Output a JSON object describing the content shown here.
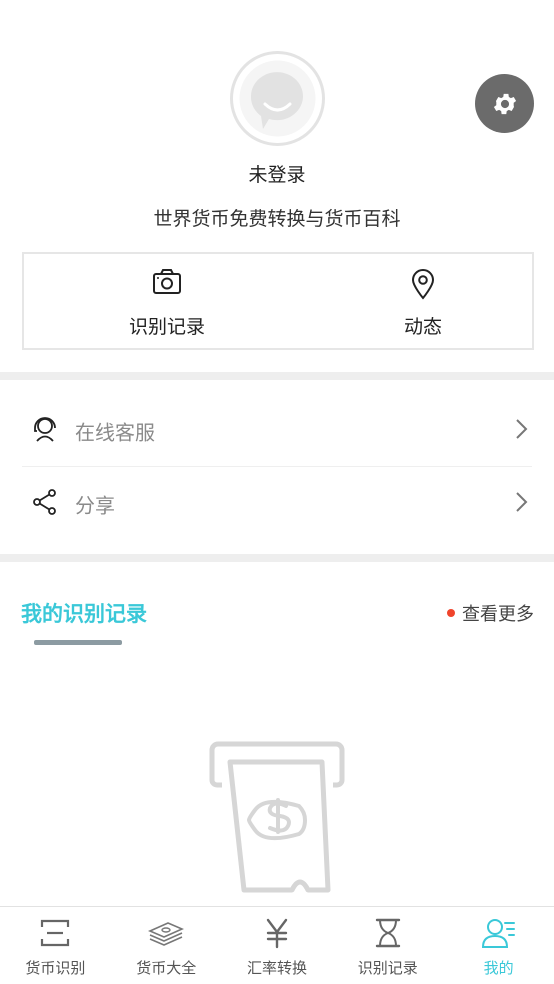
{
  "profile": {
    "login_status": "未登录",
    "subtitle": "世界货币免费转换与货币百科",
    "avatar_icon": "chat-bubble-smile-icon",
    "settings_icon": "gear-icon"
  },
  "quick_actions": [
    {
      "label": "识别记录",
      "icon": "camera-icon"
    },
    {
      "label": "动态",
      "icon": "location-pin-icon"
    }
  ],
  "menu": [
    {
      "label": "在线客服",
      "icon": "headset-agent-icon"
    },
    {
      "label": "分享",
      "icon": "share-icon"
    }
  ],
  "records": {
    "title": "我的识别记录",
    "more_label": "查看更多",
    "empty_icon": "atm-cash-icon"
  },
  "tabbar": {
    "active_index": 4,
    "tabs": [
      {
        "label": "货币识别",
        "icon": "scan-frame-icon"
      },
      {
        "label": "货币大全",
        "icon": "money-stack-icon"
      },
      {
        "label": "汇率转换",
        "icon": "yen-icon"
      },
      {
        "label": "识别记录",
        "icon": "hourglass-icon"
      },
      {
        "label": "我的",
        "icon": "user-list-icon"
      }
    ]
  },
  "colors": {
    "accent": "#3ac8d8",
    "settings_bg": "#6b6b6b",
    "badge_dot": "#f0442c",
    "divider": "#eeeeee"
  }
}
